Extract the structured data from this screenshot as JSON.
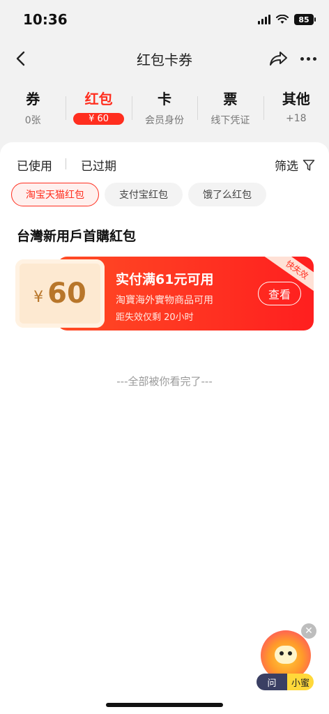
{
  "status_bar": {
    "time": "10:36",
    "battery": "85"
  },
  "nav": {
    "title": "红包卡券"
  },
  "categories": [
    {
      "title": "券",
      "sub": "0张"
    },
    {
      "title": "红包",
      "sub": "¥ 60"
    },
    {
      "title": "卡",
      "sub": "会员身份"
    },
    {
      "title": "票",
      "sub": "线下凭证"
    },
    {
      "title": "其他",
      "sub": "+18"
    }
  ],
  "filters": {
    "used": "已使用",
    "expired": "已过期",
    "filter_label": "筛选"
  },
  "chips": [
    "淘宝天猫红包",
    "支付宝红包",
    "饿了么红包"
  ],
  "section_title": "台灣新用戶首購紅包",
  "coupon": {
    "currency": "¥",
    "amount": "60",
    "condition": "实付满61元可用",
    "scope": "淘寶海外實物商品可用",
    "expiry": "距失效仅剩 20小时",
    "ribbon": "快失效",
    "view_label": "查看"
  },
  "end_text": "---全部被你看完了---",
  "assistant": {
    "ask": "问",
    "name": "小蜜"
  },
  "colors": {
    "accent": "#ff2e1f",
    "coupon_gold": "#b8762a"
  }
}
